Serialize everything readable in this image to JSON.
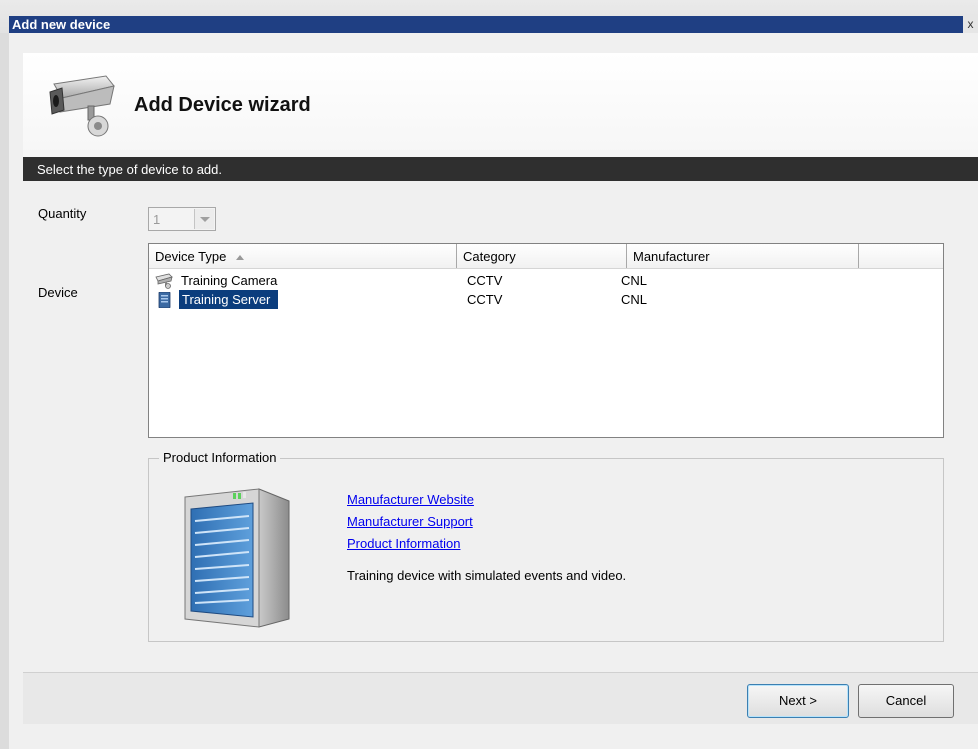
{
  "window": {
    "title": "Add new device",
    "close_glyph": "x"
  },
  "wizard": {
    "title": "Add Device wizard",
    "instruction": "Select the type of device to add."
  },
  "form": {
    "quantity_label": "Quantity",
    "quantity_value": "1",
    "device_label": "Device"
  },
  "device_list": {
    "columns": [
      "Device Type",
      "Category",
      "Manufacturer"
    ],
    "sorted_column": "Device Type",
    "rows": [
      {
        "name": "Training Camera",
        "category": "CCTV",
        "manufacturer": "CNL",
        "icon": "camera-icon",
        "selected": false
      },
      {
        "name": "Training Server",
        "category": "CCTV",
        "manufacturer": "CNL",
        "icon": "server-icon",
        "selected": true
      }
    ]
  },
  "product_info": {
    "legend": "Product Information",
    "links": [
      "Manufacturer Website",
      "Manufacturer Support",
      "Product Information"
    ],
    "description": "Training device with simulated events and video."
  },
  "buttons": {
    "next": "Next >",
    "cancel": "Cancel"
  },
  "colors": {
    "titlebar": "#1f3f83",
    "instruction_bar": "#2f2f2f",
    "selection": "#0b3d7d",
    "link": "#0000ee"
  }
}
